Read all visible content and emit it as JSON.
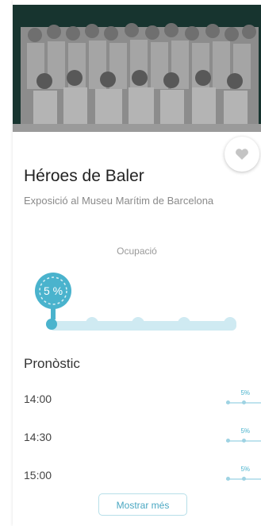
{
  "event": {
    "title": "Héroes de Baler",
    "subtitle": "Exposició al Museu Marítim de Barcelona"
  },
  "occupancy": {
    "label": "Ocupació",
    "percent": 5,
    "value_text": "5  %",
    "accent_color": "#4ab3cd",
    "track_color": "#cfeaf2"
  },
  "forecast": {
    "title": "Pronòstic",
    "rows": [
      {
        "time": "14:00",
        "percent": "5%"
      },
      {
        "time": "14:30",
        "percent": "5%"
      },
      {
        "time": "15:00",
        "percent": "5%"
      }
    ]
  },
  "actions": {
    "favorite_icon": "heart-icon",
    "show_more_label": "Mostrar més"
  }
}
